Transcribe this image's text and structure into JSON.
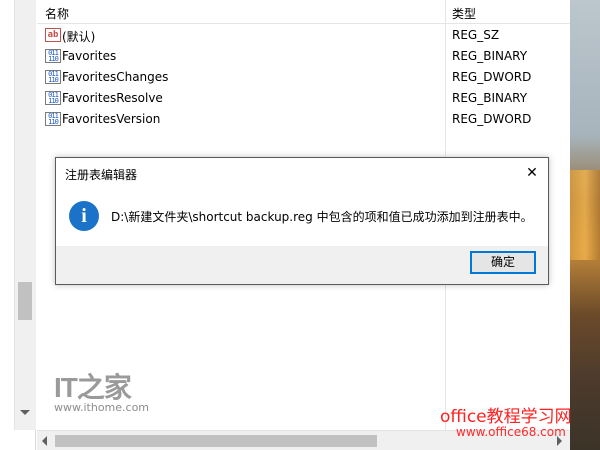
{
  "list": {
    "columns": {
      "name": "名称",
      "type": "类型"
    },
    "rows": [
      {
        "icon": "ab",
        "kind": "string-value-icon",
        "name": "(默认)",
        "type": "REG_SZ"
      },
      {
        "icon": "011 110",
        "kind": "binary-value-icon",
        "name": "Favorites",
        "type": "REG_BINARY"
      },
      {
        "icon": "011 110",
        "kind": "binary-value-icon",
        "name": "FavoritesChanges",
        "type": "REG_DWORD"
      },
      {
        "icon": "011 110",
        "kind": "binary-value-icon",
        "name": "FavoritesResolve",
        "type": "REG_BINARY"
      },
      {
        "icon": "011 110",
        "kind": "binary-value-icon",
        "name": "FavoritesVersion",
        "type": "REG_DWORD"
      }
    ]
  },
  "dialog": {
    "title": "注册表编辑器",
    "close_glyph": "✕",
    "icon_glyph": "i",
    "message": "D:\\新建文件夹\\shortcut backup.reg 中包含的项和值已成功添加到注册表中。",
    "ok_label": "确定",
    "accent": "#0078d7"
  },
  "watermarks": {
    "it_logo": "IT之家",
    "it_url": "www.ithome.com",
    "office_text": "office教程学习网",
    "office_url": "www.office68.com"
  }
}
